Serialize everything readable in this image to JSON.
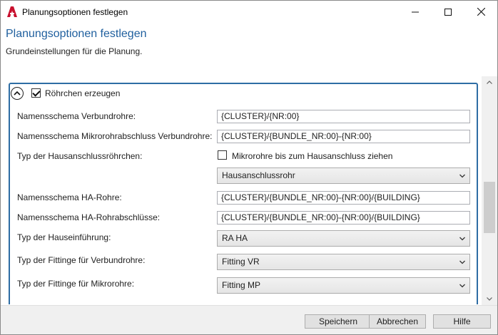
{
  "window": {
    "title": "Planungsoptionen festlegen",
    "app_icon": "autocad-a-icon"
  },
  "header": {
    "title": "Planungsoptionen festlegen",
    "subtitle": "Grundeinstellungen für die Planung."
  },
  "group": {
    "label": "Röhrchen erzeugen",
    "checked": true,
    "collapse_icon": "chevron-up-circle-icon"
  },
  "fields": {
    "verbundrohre_label": "Namensschema Verbundrohre:",
    "verbundrohre_value": "{CLUSTER}/{NR:00}",
    "mikro_abschluss_label": "Namensschema Mikrorohrabschluss Verbundrohre:",
    "mikro_abschluss_value": "{CLUSTER}/{BUNDLE_NR:00}-{NR:00}",
    "hausanschluss_typ_label": "Typ der Hausanschlussröhrchen:",
    "hausanschluss_check_label": "Mikrorohre bis zum Hausanschluss ziehen",
    "hausanschluss_check_checked": false,
    "hausanschluss_combo": "Hausanschlussrohr",
    "ha_rohre_label": "Namensschema HA-Rohre:",
    "ha_rohre_value": "{CLUSTER}/{BUNDLE_NR:00}-{NR:00}/{BUILDING}",
    "ha_abschluss_label": "Namensschema HA-Rohrabschlüsse:",
    "ha_abschluss_value": "{CLUSTER}/{BUNDLE_NR:00}-{NR:00}/{BUILDING}",
    "hauseinfuehrung_label": "Typ der Hauseinführung:",
    "hauseinfuehrung_combo": "RA HA",
    "fitting_vr_label": "Typ der Fittinge für Verbundrohre:",
    "fitting_vr_combo": "Fitting VR",
    "fitting_mp_label": "Typ der Fittinge für Mikrorohre:",
    "fitting_mp_combo": "Fitting MP"
  },
  "footer": {
    "save_label": "Speichern",
    "cancel_label": "Abbrechen",
    "help_label": "Hilfe"
  },
  "colors": {
    "accent": "#2e6da4",
    "header_title": "#1f5f9e",
    "app_icon": "#c8102e"
  }
}
